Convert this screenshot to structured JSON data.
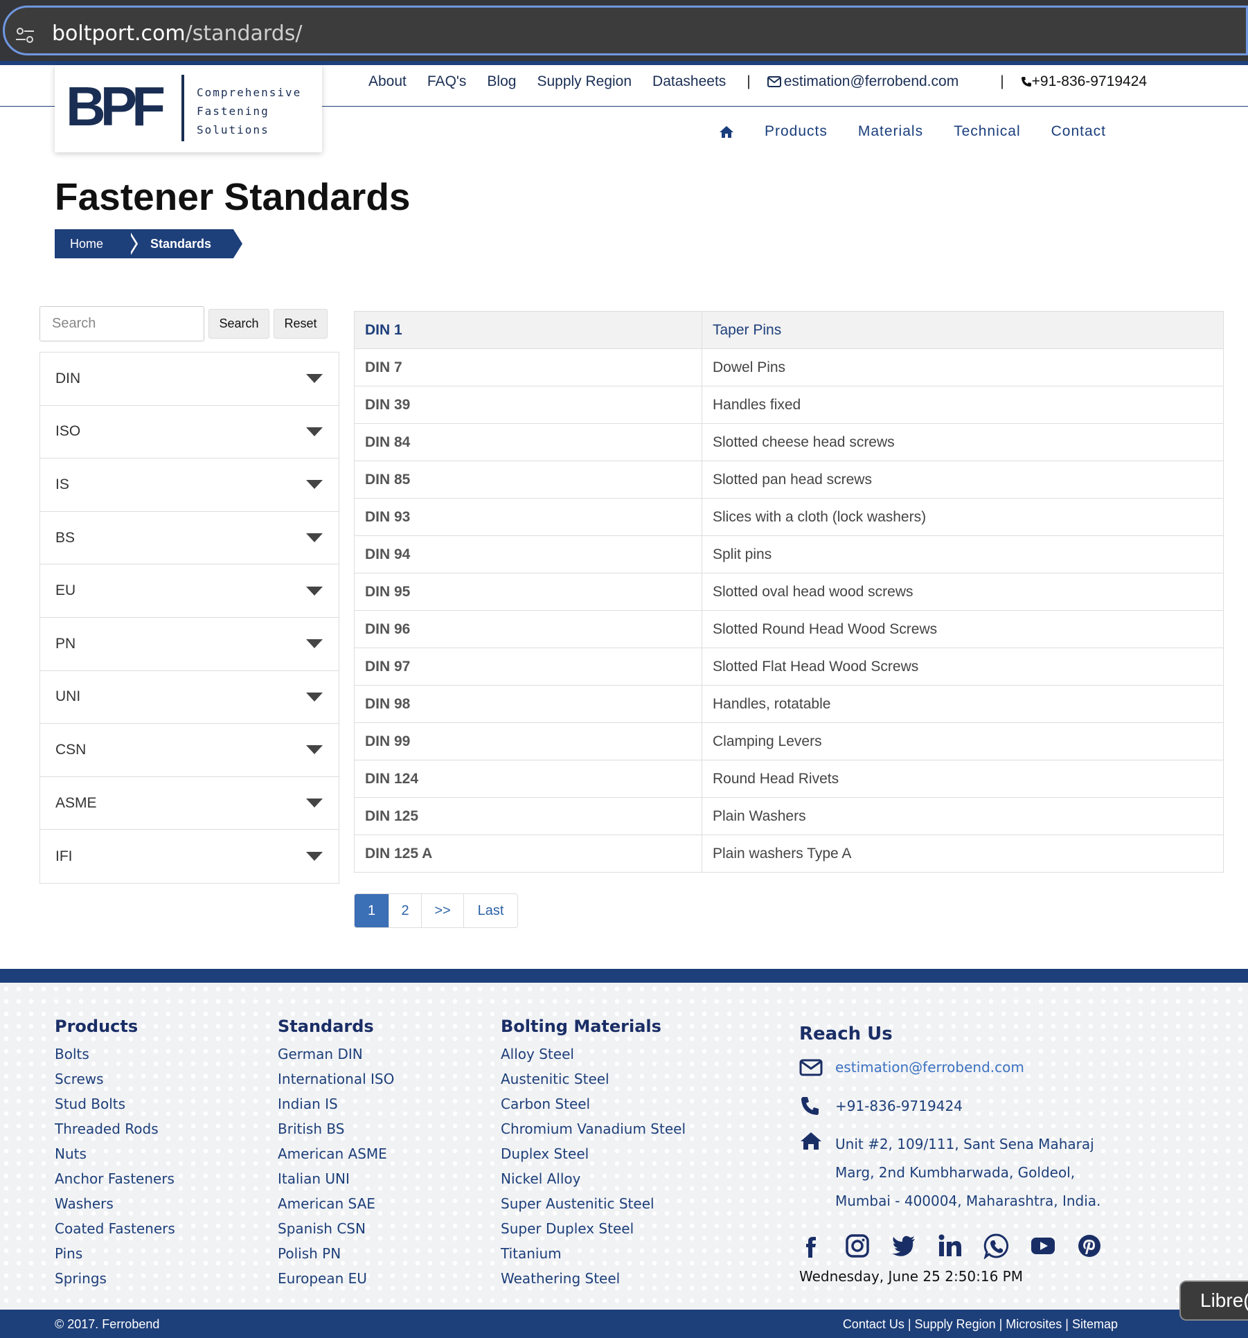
{
  "browser": {
    "url_host": "boltport.com",
    "url_path": "/standards/"
  },
  "header": {
    "logo_letters": "BPF",
    "logo_tagline": [
      "Comprehensive",
      "Fastening",
      "Solutions"
    ],
    "top_links": [
      "About",
      "FAQ's",
      "Blog",
      "Supply Region",
      "Datasheets"
    ],
    "email": "estimation@ferrobend.com",
    "phone": "+91-836-9719424",
    "main_nav": [
      "Products",
      "Materials",
      "Technical",
      "Contact"
    ]
  },
  "page": {
    "title": "Fastener Standards",
    "breadcrumb": [
      "Home",
      "Standards"
    ]
  },
  "sidebar": {
    "search_placeholder": "Search",
    "search_button": "Search",
    "reset_button": "Reset",
    "categories": [
      "DIN",
      "ISO",
      "IS",
      "BS",
      "EU",
      "PN",
      "UNI",
      "CSN",
      "ASME",
      "IFI"
    ]
  },
  "standards": [
    {
      "code": "DIN 1",
      "desc": "Taper Pins"
    },
    {
      "code": "DIN 7",
      "desc": "Dowel Pins"
    },
    {
      "code": "DIN 39",
      "desc": "Handles fixed"
    },
    {
      "code": "DIN 84",
      "desc": "Slotted cheese head screws"
    },
    {
      "code": "DIN 85",
      "desc": "Slotted pan head screws"
    },
    {
      "code": "DIN 93",
      "desc": "Slices with a cloth (lock washers)"
    },
    {
      "code": "DIN 94",
      "desc": "Split pins"
    },
    {
      "code": "DIN 95",
      "desc": "Slotted oval head wood screws"
    },
    {
      "code": "DIN 96",
      "desc": "Slotted Round Head Wood Screws"
    },
    {
      "code": "DIN 97",
      "desc": "Slotted Flat Head Wood Screws"
    },
    {
      "code": "DIN 98",
      "desc": "Handles, rotatable"
    },
    {
      "code": "DIN 99",
      "desc": "Clamping Levers"
    },
    {
      "code": "DIN 124",
      "desc": "Round Head Rivets"
    },
    {
      "code": "DIN 125",
      "desc": "Plain Washers"
    },
    {
      "code": "DIN 125 A",
      "desc": "Plain washers Type A"
    }
  ],
  "pagination": {
    "current": "1",
    "page2": "2",
    "next": ">>",
    "last": "Last"
  },
  "footer": {
    "products": {
      "heading": "Products",
      "items": [
        "Bolts",
        "Screws",
        "Stud Bolts",
        "Threaded Rods",
        "Nuts",
        "Anchor Fasteners",
        "Washers",
        "Coated Fasteners",
        "Pins",
        "Springs"
      ]
    },
    "standards": {
      "heading": "Standards",
      "items": [
        "German DIN",
        "International ISO",
        "Indian IS",
        "British BS",
        "American ASME",
        "Italian UNI",
        "American SAE",
        "Spanish CSN",
        "Polish PN",
        "European EU"
      ]
    },
    "materials": {
      "heading": "Bolting Materials",
      "items": [
        "Alloy Steel",
        "Austenitic Steel",
        "Carbon Steel",
        "Chromium Vanadium Steel",
        "Duplex Steel",
        "Nickel Alloy",
        "Super Austenitic Steel",
        "Super Duplex Steel",
        "Titanium",
        "Weathering Steel"
      ]
    },
    "reach": {
      "heading": "Reach Us",
      "email": "estimation@ferrobend.com",
      "phone": "+91-836-9719424",
      "address_lines": [
        "Unit #2, 109/111, Sant Sena Maharaj",
        "Marg, 2nd Kumbharwada, Goldeol,",
        "Mumbai - 400004, Maharashtra, India."
      ]
    },
    "social_icons": [
      "facebook-icon",
      "instagram-icon",
      "twitter-icon",
      "linkedin-icon",
      "whatsapp-icon",
      "youtube-icon",
      "pinterest-icon"
    ],
    "datetime": "Wednesday, June 25 2:50:16 PM",
    "copyright": "© 2017. Ferrobend",
    "bottom_links": "Contact Us | Supply Region | Microsites | Sitemap"
  },
  "overlay": {
    "libre_tab": "Libre("
  },
  "colors": {
    "brand_navy": "#1d3f7a",
    "link_blue": "#2d62a8",
    "active_page": "#3b6fb6"
  }
}
